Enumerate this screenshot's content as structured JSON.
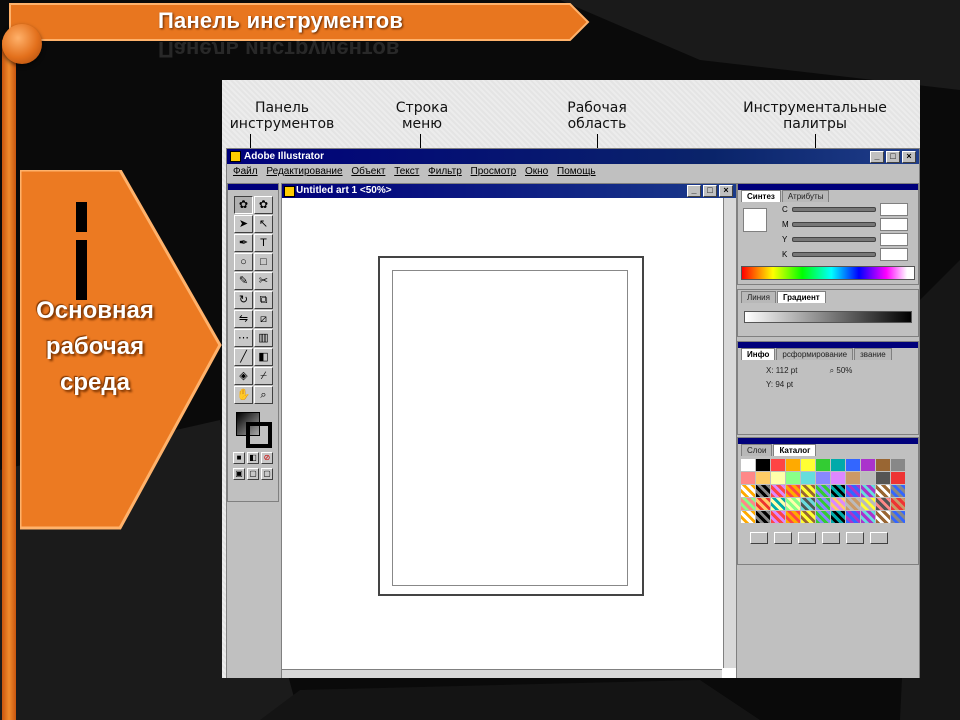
{
  "slide": {
    "title": "Панель инструментов",
    "side_label_lines": [
      "Основная",
      "рабочая",
      "среда"
    ]
  },
  "annotations": {
    "toolbox": [
      "Панель",
      "инструментов"
    ],
    "menu": [
      "Строка",
      "меню"
    ],
    "workarea": [
      "Рабочая",
      "область"
    ],
    "palettes": [
      "Инструментальные",
      "палитры"
    ]
  },
  "app": {
    "title": "Adobe Illustrator",
    "menu": [
      "Файл",
      "Редактирование",
      "Объект",
      "Текст",
      "Фильтр",
      "Просмотр",
      "Окно",
      "Помощь"
    ],
    "document_title": "Untitled art 1 <50%>",
    "window_buttons": [
      "_",
      "□",
      "×"
    ]
  },
  "palettes": {
    "color": {
      "tabs": [
        "Синтез",
        "Атрибуты"
      ],
      "channels": [
        "C",
        "M",
        "Y",
        "K"
      ]
    },
    "gradient": {
      "tabs": [
        "Линия",
        "Градиент"
      ]
    },
    "info": {
      "tabs": [
        "Инфо",
        "рсформирование",
        "звание"
      ],
      "x": "X:  112 pt",
      "y": "Y:   94 pt",
      "zoom": "50%"
    },
    "swatches": {
      "tabs": [
        "Слои",
        "Каталог"
      ]
    }
  },
  "colors": {
    "accent_orange": "#f08a2c",
    "title_blue": "#00007b",
    "ui_gray": "#c0c0c0"
  }
}
